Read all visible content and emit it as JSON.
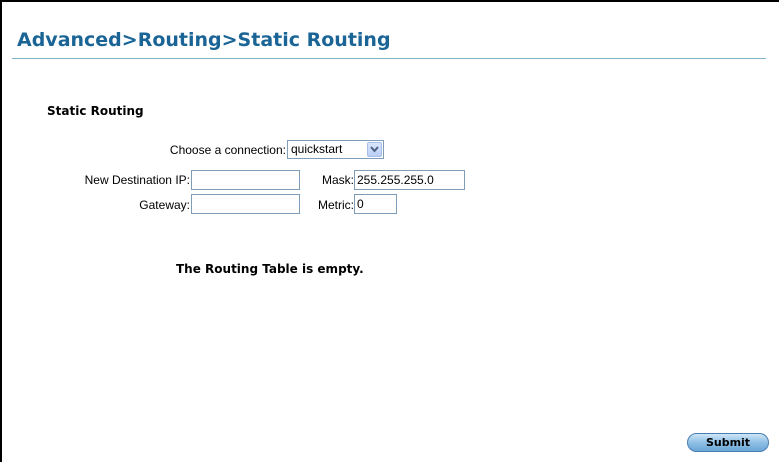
{
  "page": {
    "title": "Advanced>Routing>Static Routing",
    "section_title": "Static Routing"
  },
  "form": {
    "connection_label": "Choose a connection:",
    "connection_value": "quickstart",
    "dest_ip_label": "New Destination IP:",
    "dest_ip_value": "",
    "mask_label": "Mask:",
    "mask_value": "255.255.255.0",
    "gateway_label": "Gateway:",
    "gateway_value": "",
    "metric_label": "Metric:",
    "metric_value": "0"
  },
  "routing_table": {
    "empty_message": "The Routing Table is empty."
  },
  "actions": {
    "submit_label": "Submit"
  },
  "colors": {
    "title": "#1a6496",
    "rule": "#7fb3cc",
    "button": "#8fc0e6"
  }
}
